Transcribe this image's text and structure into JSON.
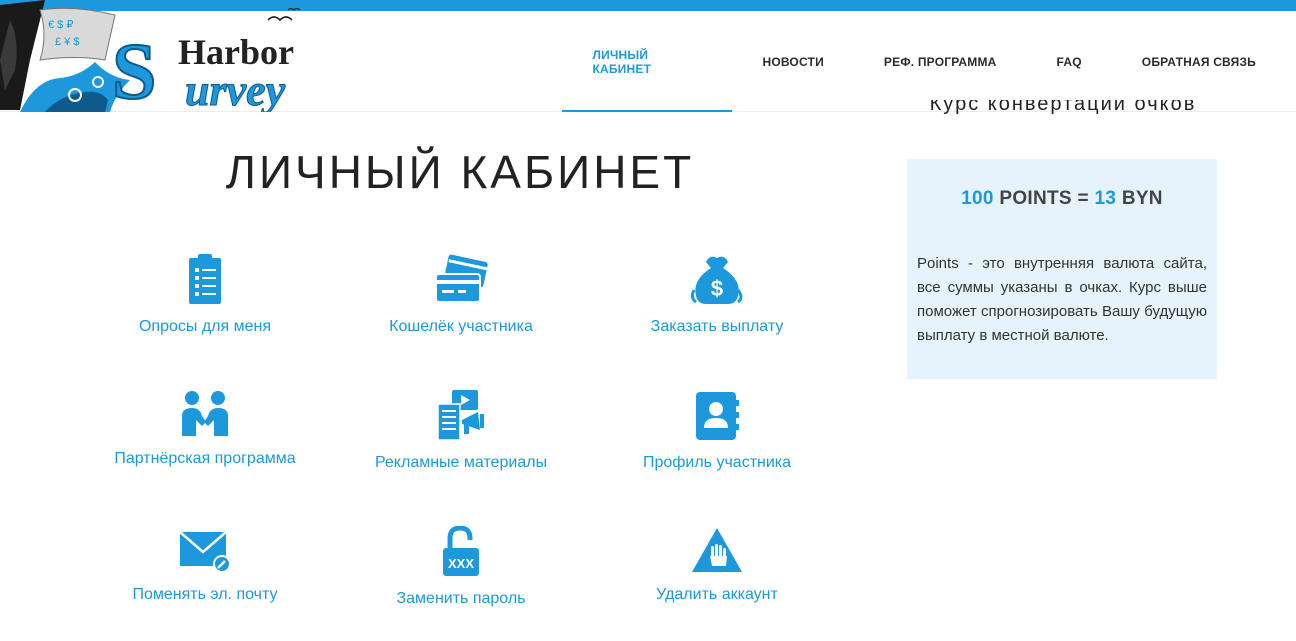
{
  "header": {
    "logo_word_top": "Harbor",
    "logo_word_bottom": "urvey",
    "logo_initial": "S"
  },
  "nav": {
    "items": [
      {
        "label": "ЛИЧНЫЙ КАБИНЕТ",
        "active": true
      },
      {
        "label": "НОВОСТИ",
        "active": false
      },
      {
        "label": "РЕФ. ПРОГРАММА",
        "active": false
      },
      {
        "label": "FAQ",
        "active": false
      },
      {
        "label": "ОБРАТНАЯ СВЯЗЬ",
        "active": false
      }
    ]
  },
  "page": {
    "title": "ЛИЧНЫЙ КАБИНЕТ"
  },
  "tiles": [
    {
      "label": "Опросы для меня",
      "icon": "clipboard-icon"
    },
    {
      "label": "Кошелёк участника",
      "icon": "credit-card-icon"
    },
    {
      "label": "Заказать выплату",
      "icon": "money-bag-icon"
    },
    {
      "label": "Партнёрская программа",
      "icon": "handshake-icon"
    },
    {
      "label": "Рекламные материалы",
      "icon": "promo-materials-icon"
    },
    {
      "label": "Профиль участника",
      "icon": "profile-book-icon"
    },
    {
      "label": "Поменять эл. почту",
      "icon": "envelope-edit-icon"
    },
    {
      "label": "Заменить пароль",
      "icon": "padlock-icon"
    },
    {
      "label": "Удалить аккаунт",
      "icon": "warning-hand-icon"
    }
  ],
  "sidebar": {
    "heading": "Курс конвертации очков",
    "rate_points": "100",
    "rate_points_unit": "POINTS",
    "rate_eq": "=",
    "rate_value": "13",
    "rate_currency": "BYN",
    "description": "Points - это внутренняя валюта сайта, все суммы указаны в очках. Курс выше поможет спрогнозировать Вашу будущую выплату в местной валюте."
  },
  "colors": {
    "accent": "#1e98dc",
    "sidebar_bg": "#e6f3fc"
  }
}
